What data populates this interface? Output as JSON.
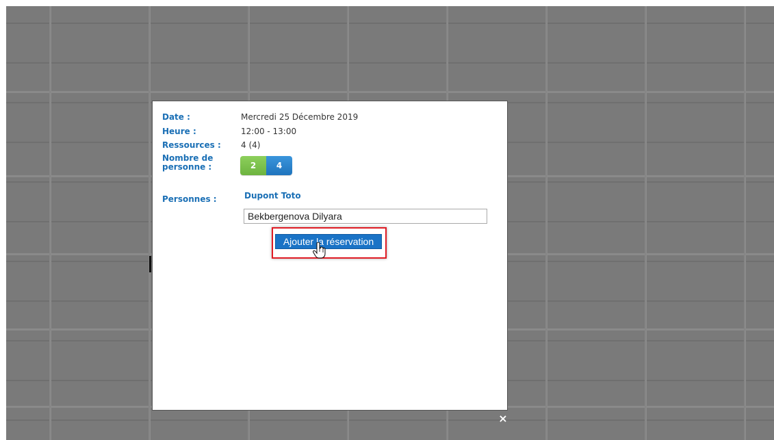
{
  "reservation": {
    "date_label": "Date :",
    "date_value": "Mercredi 25 Décembre 2019",
    "hour_label": "Heure :",
    "hour_value": "12:00 - 13:00",
    "resources_label": "Ressources :",
    "resources_value": "4 (4)",
    "people_count_label_line1": "Nombre de",
    "people_count_label_line2": "personne :",
    "people_count_badges": [
      "2",
      "4"
    ],
    "persons_label": "Personnes :",
    "person_name": "Dupont Toto",
    "person_input_value": "Bekbergenova Dilyara",
    "add_button_label": "Ajouter la réservation",
    "close_symbol": "×"
  },
  "colors": {
    "accent": "#1a6fb5",
    "badge_green": "#6db33f",
    "badge_blue": "#1f74bd",
    "highlight": "#e01b24",
    "overlay": "#7a7a7a"
  },
  "icons": {
    "cursor": "hand-pointer-icon",
    "close": "close-icon"
  }
}
